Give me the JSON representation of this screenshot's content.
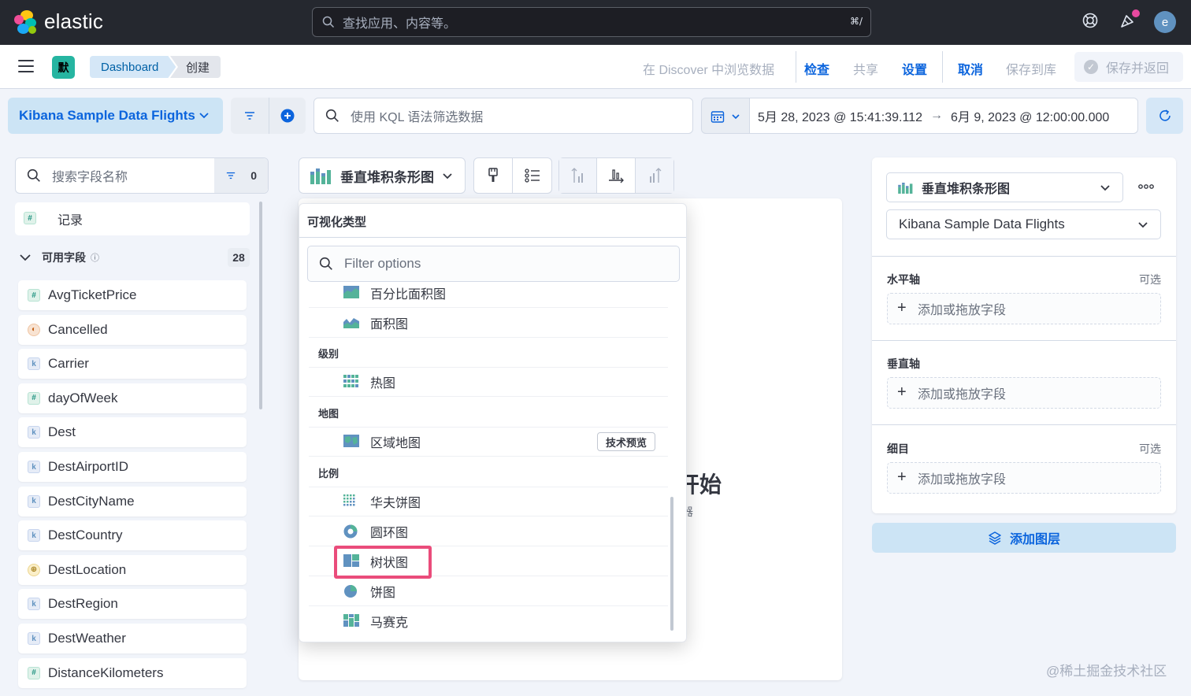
{
  "header": {
    "brand": "elastic",
    "search_placeholder": "查找应用、内容等。",
    "search_shortcut": "⌘/",
    "avatar_initial": "e"
  },
  "subnav": {
    "space_badge": "默",
    "breadcrumbs": [
      "Dashboard",
      "创建"
    ],
    "links": {
      "discover": "在 Discover 中浏览数据",
      "inspect": "检查",
      "share": "共享",
      "settings": "设置",
      "cancel": "取消",
      "save_to_library": "保存到库",
      "save_and_return": "保存并返回"
    }
  },
  "query_bar": {
    "data_view": "Kibana Sample Data Flights",
    "kql_placeholder": "使用 KQL 语法筛选数据",
    "date_start": "5月 28, 2023 @ 15:41:39.112",
    "date_arrow": "→",
    "date_end": "6月 9, 2023 @ 12:00:00.000"
  },
  "field_list": {
    "search_placeholder": "搜索字段名称",
    "filter_count": "0",
    "records_label": "记录",
    "available_label": "可用字段",
    "available_count": "28",
    "fields": [
      {
        "name": "AvgTicketPrice",
        "type": "number",
        "token": "#"
      },
      {
        "name": "Cancelled",
        "type": "boolean",
        "token": "◐"
      },
      {
        "name": "Carrier",
        "type": "keyword",
        "token": "k"
      },
      {
        "name": "dayOfWeek",
        "type": "number",
        "token": "#"
      },
      {
        "name": "Dest",
        "type": "keyword",
        "token": "k"
      },
      {
        "name": "DestAirportID",
        "type": "keyword",
        "token": "k"
      },
      {
        "name": "DestCityName",
        "type": "keyword",
        "token": "k"
      },
      {
        "name": "DestCountry",
        "type": "keyword",
        "token": "k"
      },
      {
        "name": "DestLocation",
        "type": "geo_point",
        "token": "⊕"
      },
      {
        "name": "DestRegion",
        "type": "keyword",
        "token": "k"
      },
      {
        "name": "DestWeather",
        "type": "keyword",
        "token": "k"
      },
      {
        "name": "DistanceKilometers",
        "type": "number",
        "token": "#"
      }
    ]
  },
  "workspace": {
    "vis_type": "垂直堆积条形图",
    "title_fragment": "开始",
    "sub_fragment": "器"
  },
  "popover": {
    "title": "可视化类型",
    "filter_placeholder": "Filter options",
    "items": {
      "pct_area": "百分比面积图",
      "area": "面积图",
      "group_level": "级别",
      "heatmap": "热图",
      "group_map": "地图",
      "region_map": "区域地图",
      "tech_preview": "技术预览",
      "group_proportion": "比例",
      "waffle": "华夫饼图",
      "donut": "圆环图",
      "treemap": "树状图",
      "pie": "饼图",
      "mosaic": "马赛克"
    }
  },
  "config": {
    "vis_type": "垂直堆积条形图",
    "data_view": "Kibana Sample Data Flights",
    "horizontal_axis": "水平轴",
    "vertical_axis": "垂直轴",
    "breakdown": "细目",
    "optional": "可选",
    "drop_hint": "添加或拖放字段",
    "add_layer": "添加图层"
  },
  "watermark": "@稀土掘金技术社区",
  "colors": {
    "accent": "#0b64dd",
    "header_bg": "#25282f",
    "highlight": "#ea4c7b"
  }
}
